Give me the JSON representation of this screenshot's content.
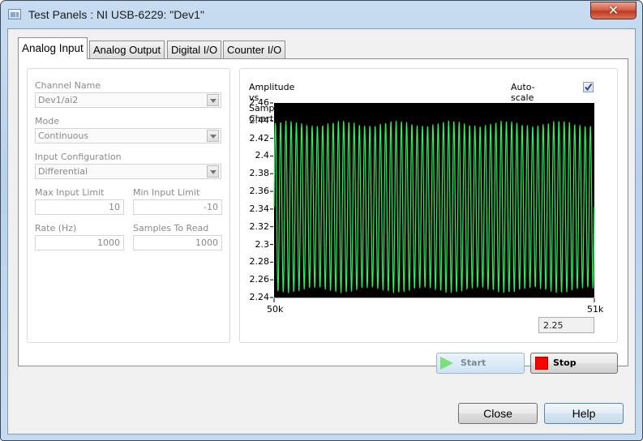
{
  "window": {
    "title": "Test Panels : NI USB-6229: \"Dev1\"",
    "close_glyph": "✕"
  },
  "tabs": [
    {
      "label": "Analog Input",
      "active": true
    },
    {
      "label": "Analog Output",
      "active": false
    },
    {
      "label": "Digital I/O",
      "active": false
    },
    {
      "label": "Counter I/O",
      "active": false
    }
  ],
  "settings": {
    "channel_name": {
      "label": "Channel Name",
      "value": "Dev1/ai2"
    },
    "mode": {
      "label": "Mode",
      "value": "Continuous"
    },
    "input_configuration": {
      "label": "Input Configuration",
      "value": "Differential"
    },
    "max_input_limit": {
      "label": "Max Input Limit",
      "value": "10"
    },
    "min_input_limit": {
      "label": "Min Input Limit",
      "value": "-10"
    },
    "rate": {
      "label": "Rate (Hz)",
      "value": "1000"
    },
    "samples_to_read": {
      "label": "Samples To Read",
      "value": "1000"
    }
  },
  "chart_panel": {
    "title": "Amplitude vs. Samples Chart",
    "autoscale_label": "Auto-scale chart",
    "autoscale_checked": true,
    "cursor_value": "2.25",
    "trace_color": "#2af05c",
    "background_color": "#000000"
  },
  "chart_data": {
    "type": "line",
    "title": "Amplitude vs. Samples Chart",
    "xlabel": "",
    "ylabel": "",
    "xlim": [
      50000,
      51000
    ],
    "ylim": [
      2.24,
      2.46
    ],
    "x_ticks": [
      "50k",
      "51k"
    ],
    "y_ticks": [
      "2.46",
      "2.44",
      "2.42",
      "2.4",
      "2.38",
      "2.36",
      "2.34",
      "2.32",
      "2.3",
      "2.28",
      "2.26",
      "2.24"
    ],
    "y_tick_values": [
      2.46,
      2.44,
      2.42,
      2.4,
      2.38,
      2.36,
      2.34,
      2.32,
      2.3,
      2.28,
      2.26,
      2.24
    ],
    "series": [
      {
        "name": "ai2",
        "description": "periodic signal oscillating ~2.245 to ~2.44, about 60 cycles across 1000 samples",
        "min": 2.245,
        "max": 2.44,
        "cycles": 61
      }
    ],
    "grid": false,
    "legend": "none"
  },
  "buttons": {
    "start": "Start",
    "stop": "Stop",
    "close": "Close",
    "help": "Help"
  }
}
